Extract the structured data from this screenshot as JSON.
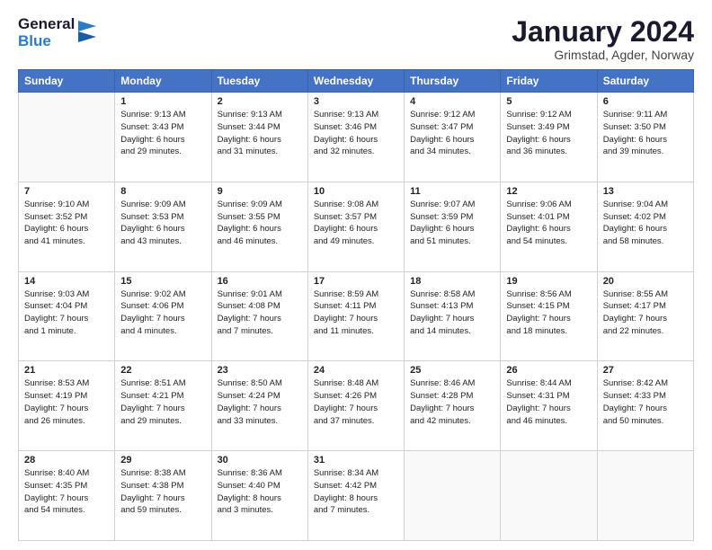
{
  "logo": {
    "line1": "General",
    "line2": "Blue"
  },
  "title": "January 2024",
  "subtitle": "Grimstad, Agder, Norway",
  "days_of_week": [
    "Sunday",
    "Monday",
    "Tuesday",
    "Wednesday",
    "Thursday",
    "Friday",
    "Saturday"
  ],
  "weeks": [
    [
      {
        "day": "",
        "info": ""
      },
      {
        "day": "1",
        "info": "Sunrise: 9:13 AM\nSunset: 3:43 PM\nDaylight: 6 hours\nand 29 minutes."
      },
      {
        "day": "2",
        "info": "Sunrise: 9:13 AM\nSunset: 3:44 PM\nDaylight: 6 hours\nand 31 minutes."
      },
      {
        "day": "3",
        "info": "Sunrise: 9:13 AM\nSunset: 3:46 PM\nDaylight: 6 hours\nand 32 minutes."
      },
      {
        "day": "4",
        "info": "Sunrise: 9:12 AM\nSunset: 3:47 PM\nDaylight: 6 hours\nand 34 minutes."
      },
      {
        "day": "5",
        "info": "Sunrise: 9:12 AM\nSunset: 3:49 PM\nDaylight: 6 hours\nand 36 minutes."
      },
      {
        "day": "6",
        "info": "Sunrise: 9:11 AM\nSunset: 3:50 PM\nDaylight: 6 hours\nand 39 minutes."
      }
    ],
    [
      {
        "day": "7",
        "info": "Sunrise: 9:10 AM\nSunset: 3:52 PM\nDaylight: 6 hours\nand 41 minutes."
      },
      {
        "day": "8",
        "info": "Sunrise: 9:09 AM\nSunset: 3:53 PM\nDaylight: 6 hours\nand 43 minutes."
      },
      {
        "day": "9",
        "info": "Sunrise: 9:09 AM\nSunset: 3:55 PM\nDaylight: 6 hours\nand 46 minutes."
      },
      {
        "day": "10",
        "info": "Sunrise: 9:08 AM\nSunset: 3:57 PM\nDaylight: 6 hours\nand 49 minutes."
      },
      {
        "day": "11",
        "info": "Sunrise: 9:07 AM\nSunset: 3:59 PM\nDaylight: 6 hours\nand 51 minutes."
      },
      {
        "day": "12",
        "info": "Sunrise: 9:06 AM\nSunset: 4:01 PM\nDaylight: 6 hours\nand 54 minutes."
      },
      {
        "day": "13",
        "info": "Sunrise: 9:04 AM\nSunset: 4:02 PM\nDaylight: 6 hours\nand 58 minutes."
      }
    ],
    [
      {
        "day": "14",
        "info": "Sunrise: 9:03 AM\nSunset: 4:04 PM\nDaylight: 7 hours\nand 1 minute."
      },
      {
        "day": "15",
        "info": "Sunrise: 9:02 AM\nSunset: 4:06 PM\nDaylight: 7 hours\nand 4 minutes."
      },
      {
        "day": "16",
        "info": "Sunrise: 9:01 AM\nSunset: 4:08 PM\nDaylight: 7 hours\nand 7 minutes."
      },
      {
        "day": "17",
        "info": "Sunrise: 8:59 AM\nSunset: 4:11 PM\nDaylight: 7 hours\nand 11 minutes."
      },
      {
        "day": "18",
        "info": "Sunrise: 8:58 AM\nSunset: 4:13 PM\nDaylight: 7 hours\nand 14 minutes."
      },
      {
        "day": "19",
        "info": "Sunrise: 8:56 AM\nSunset: 4:15 PM\nDaylight: 7 hours\nand 18 minutes."
      },
      {
        "day": "20",
        "info": "Sunrise: 8:55 AM\nSunset: 4:17 PM\nDaylight: 7 hours\nand 22 minutes."
      }
    ],
    [
      {
        "day": "21",
        "info": "Sunrise: 8:53 AM\nSunset: 4:19 PM\nDaylight: 7 hours\nand 26 minutes."
      },
      {
        "day": "22",
        "info": "Sunrise: 8:51 AM\nSunset: 4:21 PM\nDaylight: 7 hours\nand 29 minutes."
      },
      {
        "day": "23",
        "info": "Sunrise: 8:50 AM\nSunset: 4:24 PM\nDaylight: 7 hours\nand 33 minutes."
      },
      {
        "day": "24",
        "info": "Sunrise: 8:48 AM\nSunset: 4:26 PM\nDaylight: 7 hours\nand 37 minutes."
      },
      {
        "day": "25",
        "info": "Sunrise: 8:46 AM\nSunset: 4:28 PM\nDaylight: 7 hours\nand 42 minutes."
      },
      {
        "day": "26",
        "info": "Sunrise: 8:44 AM\nSunset: 4:31 PM\nDaylight: 7 hours\nand 46 minutes."
      },
      {
        "day": "27",
        "info": "Sunrise: 8:42 AM\nSunset: 4:33 PM\nDaylight: 7 hours\nand 50 minutes."
      }
    ],
    [
      {
        "day": "28",
        "info": "Sunrise: 8:40 AM\nSunset: 4:35 PM\nDaylight: 7 hours\nand 54 minutes."
      },
      {
        "day": "29",
        "info": "Sunrise: 8:38 AM\nSunset: 4:38 PM\nDaylight: 7 hours\nand 59 minutes."
      },
      {
        "day": "30",
        "info": "Sunrise: 8:36 AM\nSunset: 4:40 PM\nDaylight: 8 hours\nand 3 minutes."
      },
      {
        "day": "31",
        "info": "Sunrise: 8:34 AM\nSunset: 4:42 PM\nDaylight: 8 hours\nand 7 minutes."
      },
      {
        "day": "",
        "info": ""
      },
      {
        "day": "",
        "info": ""
      },
      {
        "day": "",
        "info": ""
      }
    ]
  ]
}
